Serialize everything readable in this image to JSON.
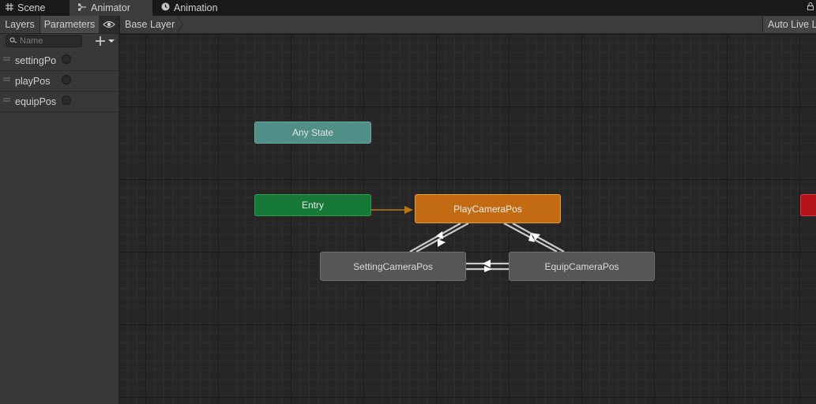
{
  "window_tabs": [
    {
      "label": "Scene",
      "icon": "grid-icon"
    },
    {
      "label": "Animator",
      "icon": "animator-icon"
    },
    {
      "label": "Animation",
      "icon": "clock-icon"
    }
  ],
  "left_panel": {
    "tabs": {
      "layers": "Layers",
      "parameters": "Parameters"
    },
    "search": {
      "placeholder": "Name",
      "value": ""
    },
    "parameters": [
      {
        "name": "settingPo",
        "value": false
      },
      {
        "name": "playPos",
        "value": false
      },
      {
        "name": "equipPos",
        "value": false
      }
    ]
  },
  "toolbar": {
    "breadcrumb": "Base Layer",
    "auto_live_link": "Auto Live L"
  },
  "graph": {
    "states": {
      "any_state": "Any State",
      "entry": "Entry",
      "play": "PlayCameraPos",
      "setting": "SettingCameraPos",
      "equip": "EquipCameraPos",
      "exit": ""
    }
  },
  "colors": {
    "any_state": "#4f8f87",
    "entry": "#167a36",
    "default_state": "#c36b12",
    "state": "#565656",
    "exit": "#b5141b",
    "default_transition": "#b9770e"
  }
}
